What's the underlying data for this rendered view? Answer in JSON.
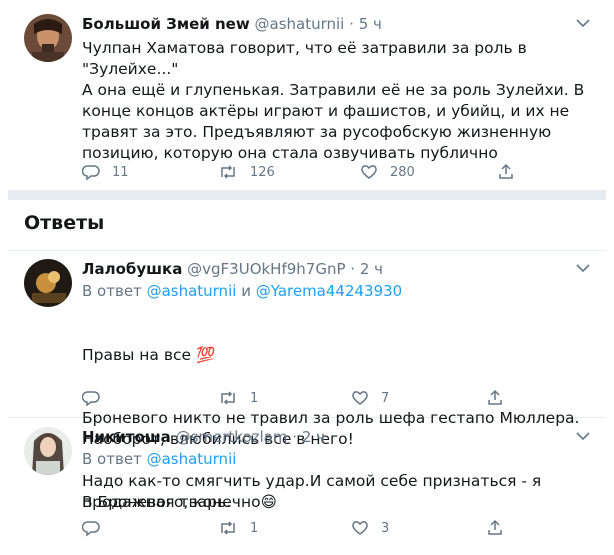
{
  "main_tweet": {
    "author_name": "Большой Змей new",
    "handle": "@ashaturnii",
    "dot": "·",
    "time": "5 ч",
    "text_line1": "Чулпан Хаматова говорит, что её затравили за роль в \"Зулейхе...\"",
    "text_para2": "А она ещё и глупенькая. Затравили её не за роль Зулейхи. В конце концов актёры играют и фашистов, и убийц, и их не травят за это. Предъявляют за русофобскую жизненную позицию, которую она стала озвучивать публично",
    "replies_count": "11",
    "retweets_count": "126",
    "likes_count": "280"
  },
  "replies_header": "Ответы",
  "replies": [
    {
      "author_name": "Лалобушка",
      "handle": "@vgF3UOkHf9h7GnP",
      "dot": "·",
      "time": "2 ч",
      "reply_prefix": "В ответ",
      "reply_user1": "@ashaturnii",
      "reply_and": "и",
      "reply_user2": "@Yarema44243930",
      "line1": "Правы на все",
      "line1_emoji": "💯",
      "line2": "Броневого никто не травил за роль шефа гестапо Мюллера. Наоборот, влюбились все в него!",
      "line3": "В Броневого, конечно",
      "line3_emoji": "😄",
      "replies_count": "",
      "retweets_count": "1",
      "likes_count": "7"
    },
    {
      "author_name": "Никитоша",
      "handle": "@smertkozlam",
      "dot": "·",
      "time": "2 ч",
      "reply_prefix": "В ответ",
      "reply_user1": "@ashaturnii",
      "text": "Надо как-то смягчить удар.И самой себе признаться - я продажная тварь.",
      "replies_count": "",
      "retweets_count": "1",
      "likes_count": "3"
    }
  ],
  "colors": {
    "accent": "#1da1f2",
    "muted": "#657786",
    "divider": "#e6ecf0",
    "text": "#14171a"
  }
}
